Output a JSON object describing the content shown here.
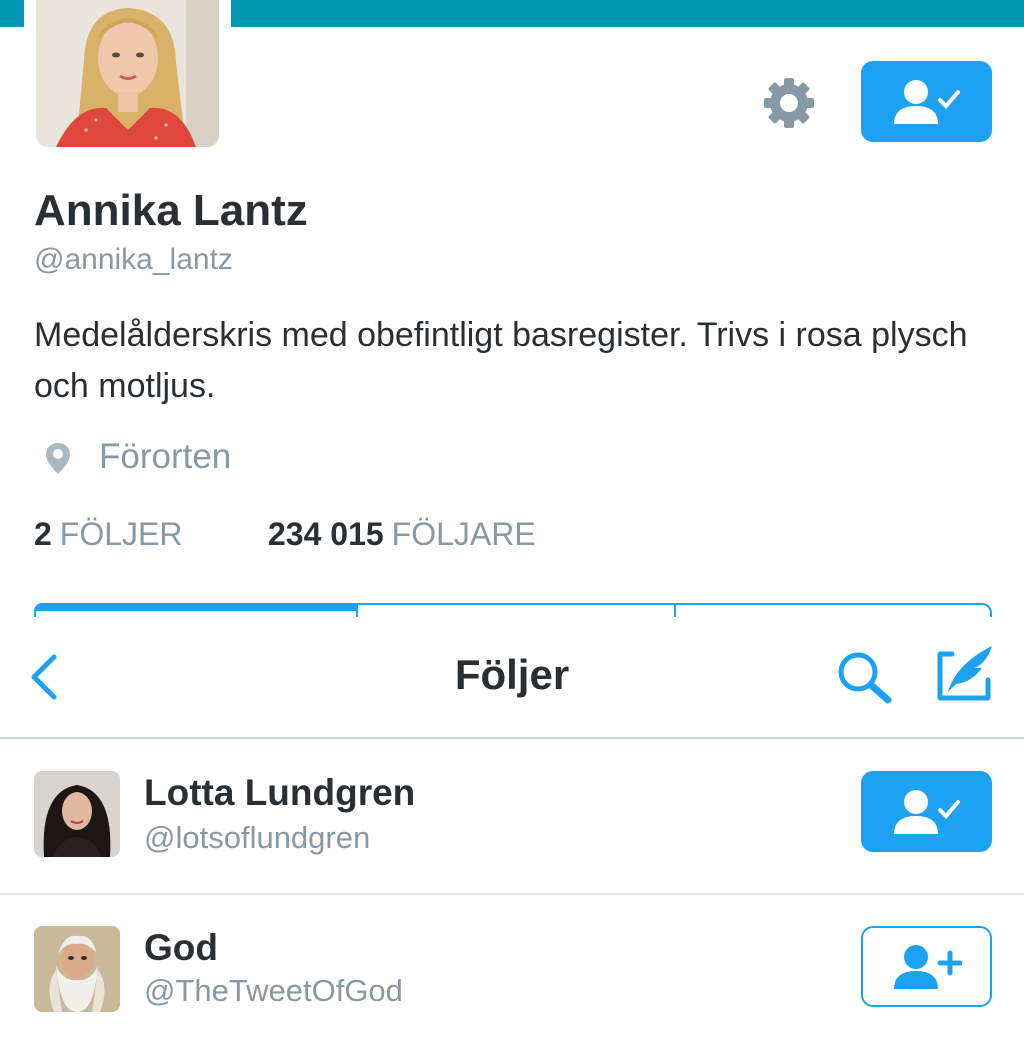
{
  "profile": {
    "name": "Annika Lantz",
    "handle": "@annika_lantz",
    "bio": "Medelålderskris med obefintligt basregister. Trivs i rosa plysch och motljus.",
    "location": "Förorten",
    "following_count": "2",
    "following_label": "FÖLJER",
    "followers_count": "234 015",
    "followers_label": "FÖLJARE",
    "follow_state": "following"
  },
  "nav": {
    "title": "Följer"
  },
  "list": [
    {
      "name": "Lotta Lundgren",
      "handle": "@lotsoflundgren",
      "follow_state": "following"
    },
    {
      "name": "God",
      "handle": "@TheTweetOfGod",
      "follow_state": "not-following"
    }
  ],
  "colors": {
    "accent": "#1da1f2",
    "banner": "#0097b2",
    "text_primary": "#292f33",
    "text_secondary": "#8899a6",
    "divider": "#e1e8ed"
  },
  "icons": [
    "gear-icon",
    "following-check-icon",
    "location-pin-icon",
    "back-chevron-icon",
    "search-icon",
    "compose-icon",
    "follow-add-icon"
  ]
}
